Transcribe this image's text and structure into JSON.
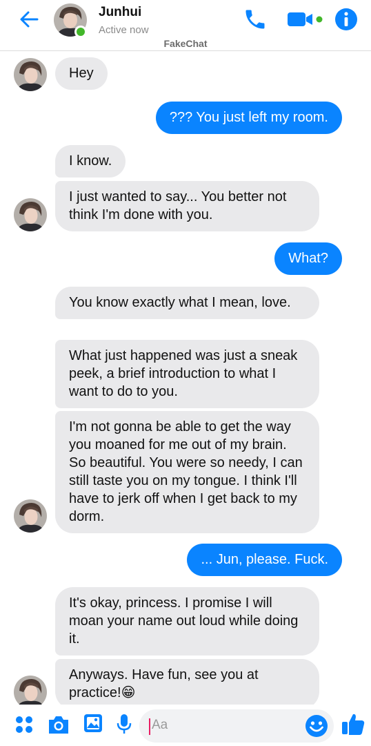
{
  "header": {
    "contact_name": "Junhui",
    "status": "Active now",
    "watermark": "FakeChat"
  },
  "colors": {
    "accent": "#0a84ff",
    "incoming_bubble": "#e9e9eb",
    "online": "#42b72a"
  },
  "icons": {
    "back": "arrow-left-icon",
    "call": "phone-icon",
    "video": "video-camera-icon",
    "info": "info-icon",
    "apps": "four-dots-icon",
    "camera": "camera-icon",
    "gallery": "image-icon",
    "voice": "microphone-icon",
    "emoji": "smiley-icon",
    "like": "thumbs-up-icon"
  },
  "messages": [
    {
      "from": "them",
      "text": "Hey"
    },
    {
      "from": "me",
      "text": "??? You just left my room."
    },
    {
      "from": "them",
      "text": "I know."
    },
    {
      "from": "them",
      "text": "I just wanted to say... You better not think I'm done with you."
    },
    {
      "from": "me",
      "text": "What?"
    },
    {
      "from": "them",
      "text": "You know exactly what I mean, love."
    },
    {
      "from": "them",
      "text": "What just happened was just a sneak peek, a brief introduction to what I want to do to you."
    },
    {
      "from": "them",
      "text": "I'm not gonna be able to get the way you moaned for me out of my brain. So beautiful. You were so needy, I can still taste you on my tongue. I think I'll have to jerk off when I get back to my dorm."
    },
    {
      "from": "me",
      "text": "... Jun, please. Fuck."
    },
    {
      "from": "them",
      "text": "It's okay, princess. I promise I will moan your name out loud while doing it."
    },
    {
      "from": "them",
      "text": "Anyways. Have fun, see you at practice!😁"
    }
  ],
  "composer": {
    "placeholder": "Aa"
  }
}
